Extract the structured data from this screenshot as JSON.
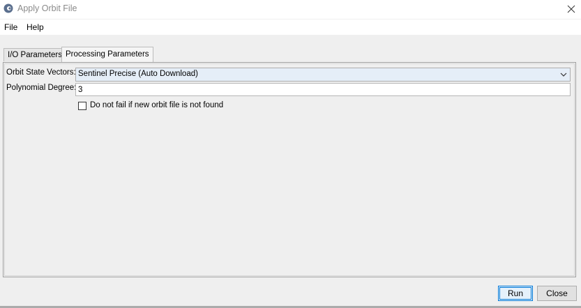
{
  "window": {
    "title": "Apply Orbit File",
    "close_icon": "close-icon"
  },
  "menu": {
    "items": [
      {
        "label": "File"
      },
      {
        "label": "Help"
      }
    ]
  },
  "tabs": [
    {
      "label": "I/O Parameters",
      "active": false
    },
    {
      "label": "Processing Parameters",
      "active": true
    }
  ],
  "form": {
    "orbit_label": "Orbit State Vectors:",
    "orbit_value": "Sentinel Precise (Auto Download)",
    "poly_label": "Polynomial Degree:",
    "poly_value": "3",
    "checkbox_label": "Do not fail if new orbit file is not found",
    "checkbox_checked": false
  },
  "buttons": {
    "run_label": "Run",
    "close_label": "Close"
  },
  "colors": {
    "accent": "#0078d7",
    "select_bg": "#e5eef8"
  }
}
